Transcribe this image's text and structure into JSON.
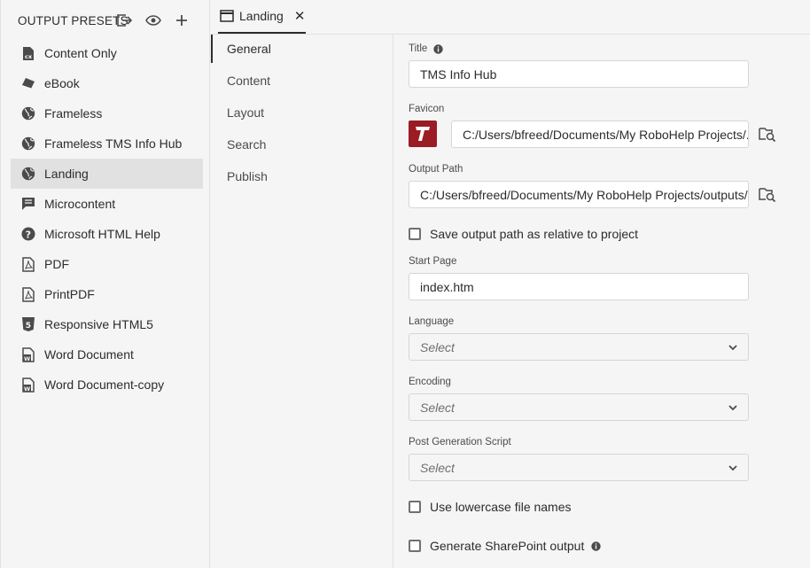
{
  "output_presets": {
    "title": "OUTPUT PRESETS",
    "header_icons": [
      "export-icon",
      "eye-icon",
      "plus-icon"
    ],
    "items": [
      {
        "label": "Content Only",
        "icon": "cx-doc-icon",
        "selected": false
      },
      {
        "label": "eBook",
        "icon": "book-icon",
        "selected": false
      },
      {
        "label": "Frameless",
        "icon": "globe-icon",
        "selected": false
      },
      {
        "label": "Frameless TMS Info Hub",
        "icon": "globe-icon",
        "selected": false
      },
      {
        "label": "Landing",
        "icon": "globe-icon",
        "selected": true
      },
      {
        "label": "Microcontent",
        "icon": "message-icon",
        "selected": false
      },
      {
        "label": "Microsoft HTML Help",
        "icon": "help-icon",
        "selected": false
      },
      {
        "label": "PDF",
        "icon": "pdf-icon",
        "selected": false
      },
      {
        "label": "PrintPDF",
        "icon": "pdf-icon",
        "selected": false
      },
      {
        "label": "Responsive HTML5",
        "icon": "html5-icon",
        "selected": false
      },
      {
        "label": "Word Document",
        "icon": "word-doc-icon",
        "selected": false
      },
      {
        "label": "Word Document-copy",
        "icon": "word-doc-icon",
        "selected": false
      }
    ]
  },
  "tab": {
    "label": "Landing",
    "close": "✕"
  },
  "nav": {
    "items": [
      {
        "label": "General",
        "selected": true
      },
      {
        "label": "Content",
        "selected": false
      },
      {
        "label": "Layout",
        "selected": false
      },
      {
        "label": "Search",
        "selected": false
      },
      {
        "label": "Publish",
        "selected": false
      }
    ]
  },
  "form": {
    "title_label": "Title",
    "title_value": "TMS Info Hub",
    "favicon_label": "Favicon",
    "favicon_path": "C:/Users/bfreed/Documents/My RoboHelp Projects/...",
    "output_path_label": "Output Path",
    "output_path": "C:/Users/bfreed/Documents/My RoboHelp Projects/outputs/...",
    "save_relative_label": "Save output path as relative to project",
    "start_page_label": "Start Page",
    "start_page_value": "index.htm",
    "language_label": "Language",
    "language_value": "Select",
    "encoding_label": "Encoding",
    "encoding_value": "Select",
    "post_gen_label": "Post Generation Script",
    "post_gen_value": "Select",
    "lowercase_label": "Use lowercase file names",
    "sharepoint_label": "Generate SharePoint output"
  },
  "colors": {
    "accent": "#2c2c2c",
    "selected_bg": "#e1e1e1",
    "favicon_red": "#9b1c24"
  }
}
